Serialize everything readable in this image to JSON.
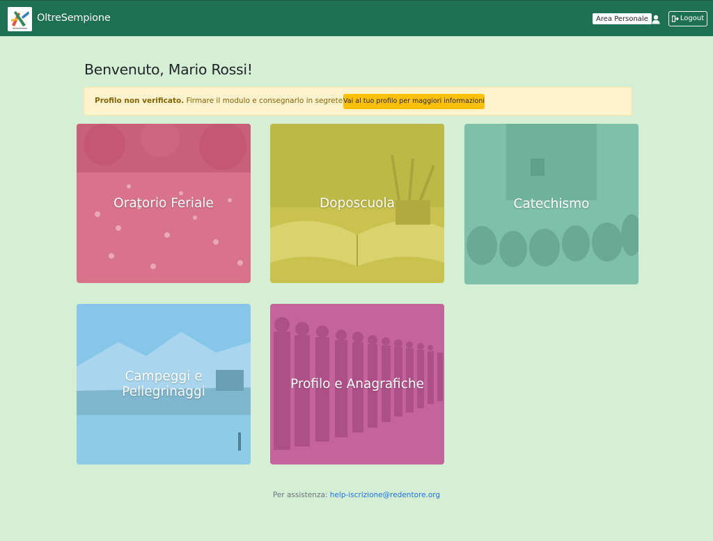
{
  "navbar": {
    "brand": "OltreSempione",
    "area_label": "Area Personale",
    "logout_label": "Logout"
  },
  "main": {
    "title": "Benvenuto, Mario Rossi!",
    "alert": {
      "strong": "Profilo non verificato.",
      "text": " Firmare il modulo e consegnarlo in segreteria.",
      "button": "Vai al tuo profilo per maggiori informazioni"
    },
    "tiles": [
      {
        "label": "Oratorio Feriale",
        "color": "#d9738c"
      },
      {
        "label": "Doposcuola",
        "color": "#c9c24f"
      },
      {
        "label": "Catechismo",
        "color": "#7ec0a9"
      },
      {
        "label": "Campeggi e Pellegrinaggi",
        "color": "#86c6e8"
      },
      {
        "label": "Profilo e Anagrafiche",
        "color": "#c5649c"
      }
    ]
  },
  "footer": {
    "prefix": "Per assistenza:",
    "email": "help-iscrizione@redentore.org"
  },
  "colors": {
    "navbar": "#1e7052",
    "background": "#d5efd5",
    "alert_bg": "#fff3cd",
    "alert_button": "#ffc107"
  }
}
